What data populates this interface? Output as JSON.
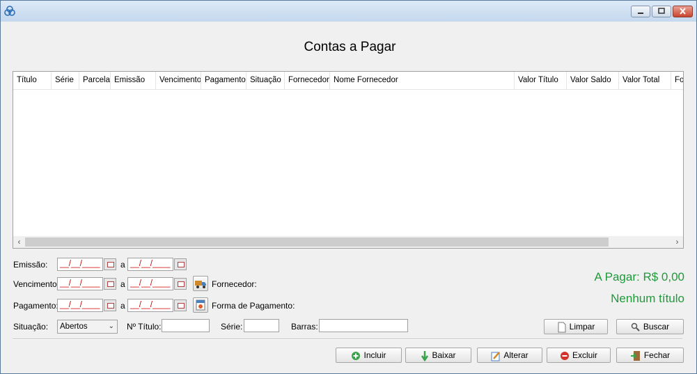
{
  "page": {
    "title": "Contas a Pagar"
  },
  "grid": {
    "columns": [
      "Título",
      "Série",
      "Parcela",
      "Emissão",
      "Vencimento",
      "Pagamento",
      "Situação",
      "Fornecedor",
      "Nome Fornecedor",
      "Valor Título",
      "Valor Saldo",
      "Valor Total",
      "Fo"
    ],
    "scroll_left": "‹",
    "scroll_right": "›"
  },
  "filters": {
    "emissao_label": "Emissão:",
    "vencimento_label": "Vencimento:",
    "pagamento_label": "Pagamento:",
    "a": "a",
    "date_mask": "__/__/____",
    "fornecedor_label": "Fornecedor:",
    "forma_pagamento_label": "Forma de Pagamento:",
    "situacao_label": "Situação:",
    "situacao_value": "Abertos",
    "ntitulo_label": "Nº Título:",
    "serie_label": "Série:",
    "barras_label": "Barras:"
  },
  "summary": {
    "a_pagar": "A Pagar: R$ 0,00",
    "status": "Nenhum título"
  },
  "buttons": {
    "limpar": "Limpar",
    "buscar": "Buscar",
    "incluir": "Incluir",
    "baixar": "Baixar",
    "alterar": "Alterar",
    "excluir": "Excluir",
    "fechar": "Fechar"
  },
  "colors": {
    "accent": "#1e9a3a",
    "date_text": "#d00000"
  }
}
